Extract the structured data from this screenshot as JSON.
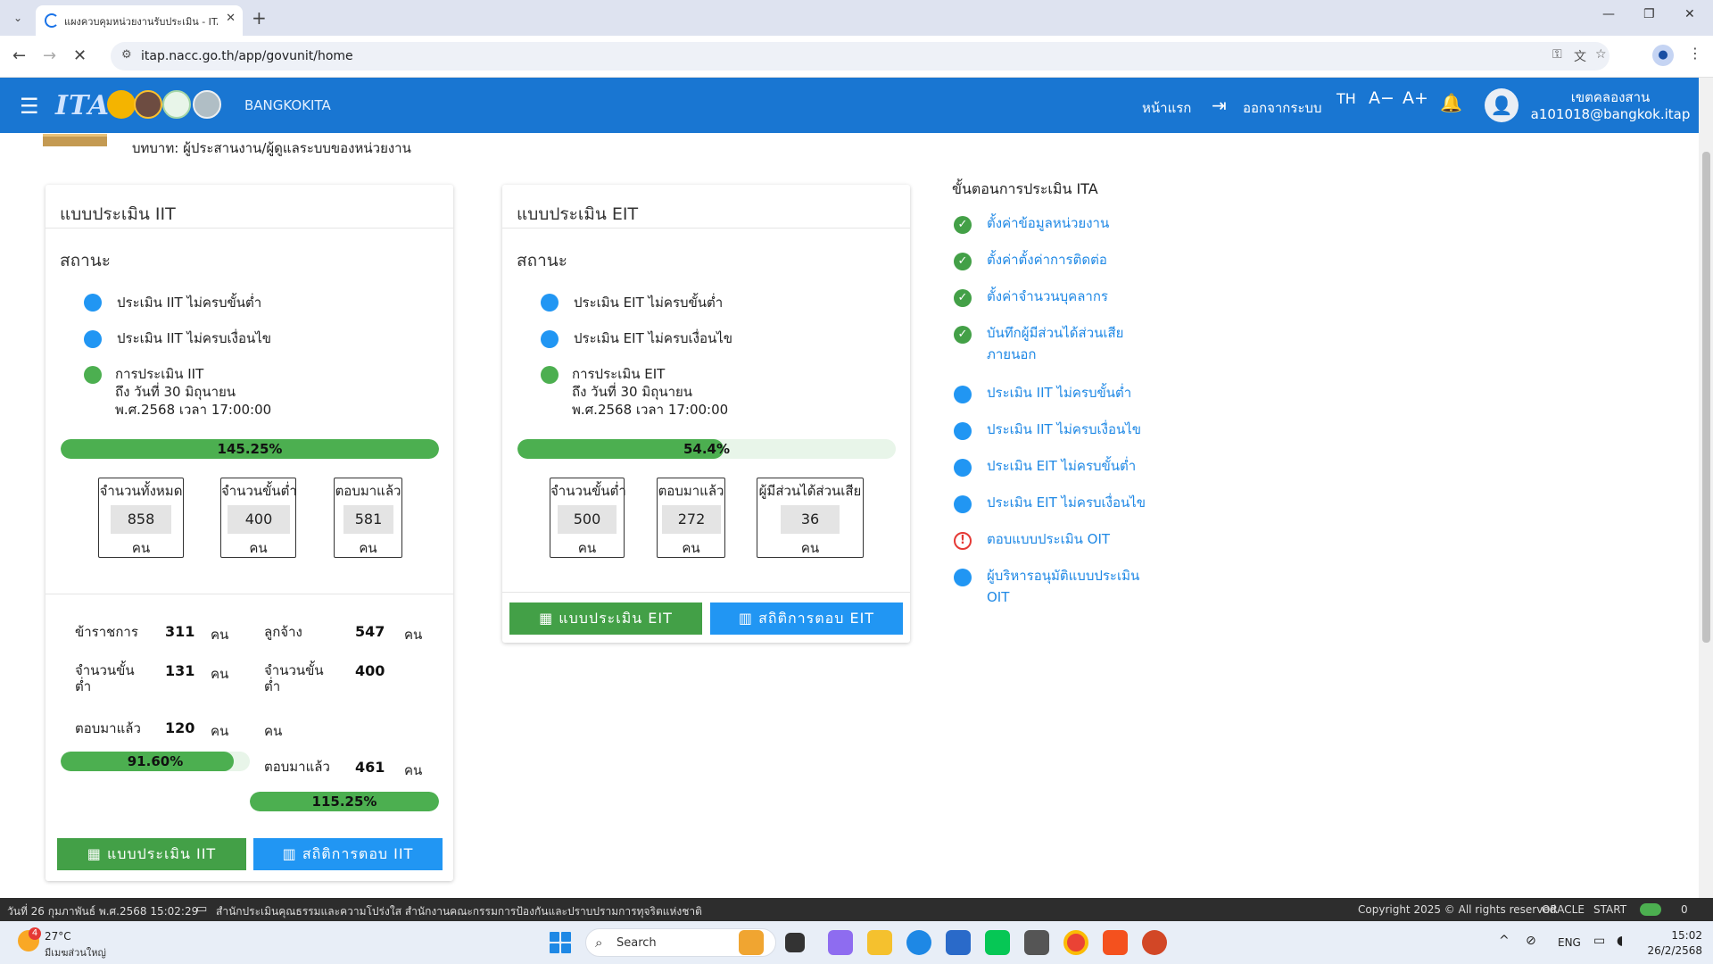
{
  "browser": {
    "tab_title": "แผงควบคุมหน่วยงานรับประเมิน - ITA",
    "tab_close": "✕",
    "new_tab": "+",
    "url": "itap.nacc.go.th/app/govunit/home",
    "window_controls": {
      "minimize": "—",
      "restore": "❐",
      "close": "✕"
    }
  },
  "app": {
    "logo_text": "ITA",
    "brand": "BANGKOKITA",
    "nav_home": "หน้าแรก",
    "nav_logout": "ออกจากระบบ",
    "lang": "TH",
    "font_smaller": "A−",
    "font_larger": "A+",
    "user_name": "เขตคลองสาน",
    "user_email": "a101018@bangkok.itap"
  },
  "page": {
    "role": "บทบาท: ผู้ประสานงาน/ผู้ดูแลระบบของหน่วยงาน"
  },
  "iit": {
    "title": "แบบประเมิน IIT",
    "status_head": "สถานะ",
    "status1": "ประเมิน IIT ไม่ครบขั้นต่ำ",
    "status2": "ประเมิน IIT ไม่ครบเงื่อนไข",
    "status3_l1": "การประเมิน IIT",
    "status3_l2": "ถึง วันที่ 30 มิถุนายน",
    "status3_l3": "พ.ศ.2568 เวลา 17:00:00",
    "progress_label": "145.25%",
    "progress_pct": 100,
    "box_total_label": "จำนวนทั้งหมด",
    "box_total": "858",
    "box_min_label": "จำนวนขั้นต่ำ",
    "box_min": "400",
    "box_resp_label": "ตอบมาแล้ว",
    "box_resp": "581",
    "unit": "คน",
    "gov_label": "ข้าราชการ",
    "gov_count": "311",
    "emp_label": "ลูกจ้าง",
    "emp_count": "547",
    "gov_min_label": "จำนวนขั้นต่ำ",
    "gov_min": "131",
    "emp_min_label": "จำนวนขั้นต่ำ",
    "emp_min": "400",
    "gov_resp_label": "ตอบมาแล้ว",
    "gov_resp": "120",
    "gov_progress_label": "91.60%",
    "gov_progress_pct": 91.6,
    "emp_resp_label": "ตอบมาแล้ว",
    "emp_resp": "461",
    "emp_progress_label": "115.25%",
    "emp_progress_pct": 100,
    "btn_form": "แบบประเมิน IIT",
    "btn_stats": "สถิติการตอบ IIT"
  },
  "eit": {
    "title": "แบบประเมิน EIT",
    "status_head": "สถานะ",
    "status1": "ประเมิน EIT ไม่ครบขั้นต่ำ",
    "status2": "ประเมิน EIT ไม่ครบเงื่อนไข",
    "status3_l1": "การประเมิน EIT",
    "status3_l2": "ถึง วันที่ 30 มิถุนายน",
    "status3_l3": "พ.ศ.2568 เวลา 17:00:00",
    "progress_label": "54.4%",
    "progress_pct": 54.4,
    "box_min_label": "จำนวนขั้นต่ำ",
    "box_min": "500",
    "box_resp_label": "ตอบมาแล้ว",
    "box_resp": "272",
    "box_stake_label": "ผู้มีส่วนได้ส่วนเสีย",
    "box_stake": "36",
    "unit": "คน",
    "btn_form": "แบบประเมิน EIT",
    "btn_stats": "สถิติการตอบ EIT"
  },
  "steps": {
    "title": "ขั้นตอนการประเมิน ITA",
    "items": [
      {
        "l1": "ตั้งค่าข้อมูลหน่วยงาน",
        "l2": "",
        "state": "done"
      },
      {
        "l1": "ตั้งค่าตั้งค่าการติดต่อ",
        "l2": "",
        "state": "done"
      },
      {
        "l1": "ตั้งค่าจำนวนบุคลากร",
        "l2": "",
        "state": "done"
      },
      {
        "l1": "บันทึกผู้มีส่วนได้ส่วนเสีย",
        "l2": "ภายนอก",
        "state": "done"
      },
      {
        "l1": "ประเมิน IIT ไม่ครบขั้นต่ำ",
        "l2": "",
        "state": "todo"
      },
      {
        "l1": "ประเมิน IIT ไม่ครบเงื่อนไข",
        "l2": "",
        "state": "todo"
      },
      {
        "l1": "ประเมิน EIT ไม่ครบขั้นต่ำ",
        "l2": "",
        "state": "todo"
      },
      {
        "l1": "ประเมิน EIT ไม่ครบเงื่อนไข",
        "l2": "",
        "state": "todo"
      },
      {
        "l1": "ตอบแบบประเมิน OIT",
        "l2": "",
        "state": "warn"
      },
      {
        "l1": "ผู้บริหารอนุมัติแบบประเมิน",
        "l2": "OIT",
        "state": "todo"
      }
    ]
  },
  "statusbar": {
    "datetime": "วันที่ 26 กุมภาพันธ์ พ.ศ.2568 15:02:29",
    "org": "สำนักประเมินคุณธรรมและความโปร่งใส สำนักงานคณะกรรมการป้องกันและปราบปรามการทุจริตแห่งชาติ",
    "copyright": "Copyright 2025 © All rights reserved",
    "oracle": "ORACLE",
    "start": "START",
    "count": "0"
  },
  "taskbar": {
    "weather_temp": "27°C",
    "weather_desc": "มีเมฆส่วนใหญ่",
    "weather_badge": "4",
    "search": "Search",
    "lang": "ENG",
    "time": "15:02",
    "date": "26/2/2568"
  }
}
